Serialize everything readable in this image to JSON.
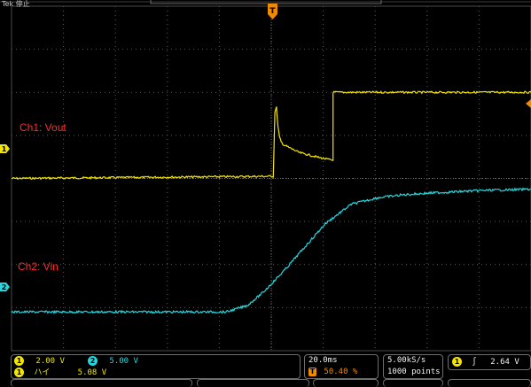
{
  "header": {
    "brand": "Tek 停止",
    "trigger_marker": "T"
  },
  "channels": [
    {
      "number": "1",
      "label": "Ch1: Vout",
      "marker": "1",
      "color": "#f3e600"
    },
    {
      "number": "2",
      "label": "Ch2: Vin",
      "marker": "2",
      "color": "#25d7de"
    }
  ],
  "bottom": {
    "ch1_scale": "2.00 V",
    "ch2_scale": "5.00 V",
    "ch1_extra_label": "ハイ",
    "ch1_extra_value": "5.08 V",
    "timebase": "20.0ms",
    "trigger_position": "50.40 %",
    "sample_rate": "5.00kS/s",
    "record_length": "1000 points",
    "trigger_source": "1",
    "trigger_slope": "∫",
    "trigger_level": "2.64 V"
  },
  "chart_data": {
    "type": "line",
    "title": "",
    "xlabel": "",
    "ylabel": "",
    "x_unit": "ms",
    "xlim": [
      -100.8,
      99.2
    ],
    "y_unit": "divisions",
    "ylim": [
      -4,
      4
    ],
    "grid": true,
    "series": [
      {
        "name": "Ch1: Vout",
        "color": "#f3e600",
        "x": [
          -100.8,
          0,
          0.6,
          1.2,
          1.8,
          2.4,
          3.0,
          4.0,
          10.0,
          18.0,
          23.0,
          23.0,
          99.2
        ],
        "y": [
          0.0,
          0.05,
          1.55,
          1.65,
          1.2,
          0.95,
          0.85,
          0.78,
          0.6,
          0.48,
          0.42,
          2.0,
          2.0
        ]
      },
      {
        "name": "Ch2: Vin",
        "color": "#25d7de",
        "x": [
          -100.8,
          -18,
          -10,
          -4,
          4,
          12,
          20,
          30,
          40,
          50,
          60,
          80,
          99.2
        ],
        "y": [
          -3.1,
          -3.1,
          -2.95,
          -2.65,
          -2.15,
          -1.6,
          -1.05,
          -0.6,
          -0.45,
          -0.38,
          -0.34,
          -0.28,
          -0.25
        ]
      }
    ]
  }
}
